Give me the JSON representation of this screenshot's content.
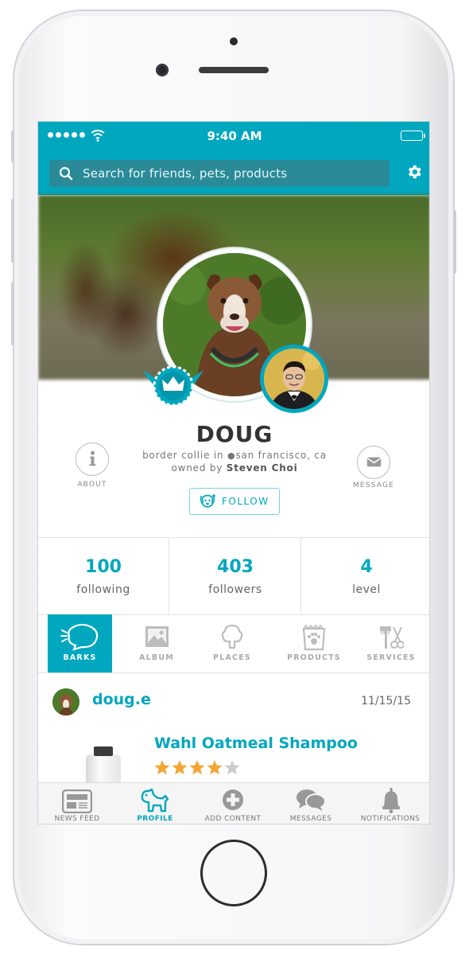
{
  "status": {
    "time": "9:40 AM"
  },
  "search": {
    "placeholder": "Search for friends, pets, products"
  },
  "profile": {
    "name": "DOUG",
    "breed_prefix": "border collie in",
    "location": "san francisco, ca",
    "owned_by_prefix": "owned by",
    "owner": "Steven Choi",
    "about_label": "ABOUT",
    "message_label": "MESSAGE",
    "follow_label": "FOLLOW"
  },
  "stats": [
    {
      "value": "100",
      "label": "following"
    },
    {
      "value": "403",
      "label": "followers"
    },
    {
      "value": "4",
      "label": "level"
    }
  ],
  "tabs": [
    {
      "label": "BARKS",
      "active": true
    },
    {
      "label": "ALBUM"
    },
    {
      "label": "PLACES"
    },
    {
      "label": "PRODUCTS"
    },
    {
      "label": "SERVICES"
    }
  ],
  "post": {
    "username": "doug.e",
    "date": "11/15/15",
    "product_title": "Wahl Oatmeal Shampoo",
    "rating": 4,
    "rating_max": 5
  },
  "bottom_nav": [
    {
      "label": "NEWS FEED",
      "icon": "newspaper-icon"
    },
    {
      "label": "PROFILE",
      "icon": "dog-icon",
      "active": true
    },
    {
      "label": "ADD CONTENT",
      "icon": "plus-circle-icon"
    },
    {
      "label": "MESSAGES",
      "icon": "chat-bubbles-icon"
    },
    {
      "label": "NOTIFICATIONS",
      "icon": "bell-icon"
    }
  ],
  "colors": {
    "accent": "#00a7bf",
    "star": "#f4a533",
    "star_empty": "#cccccc"
  }
}
